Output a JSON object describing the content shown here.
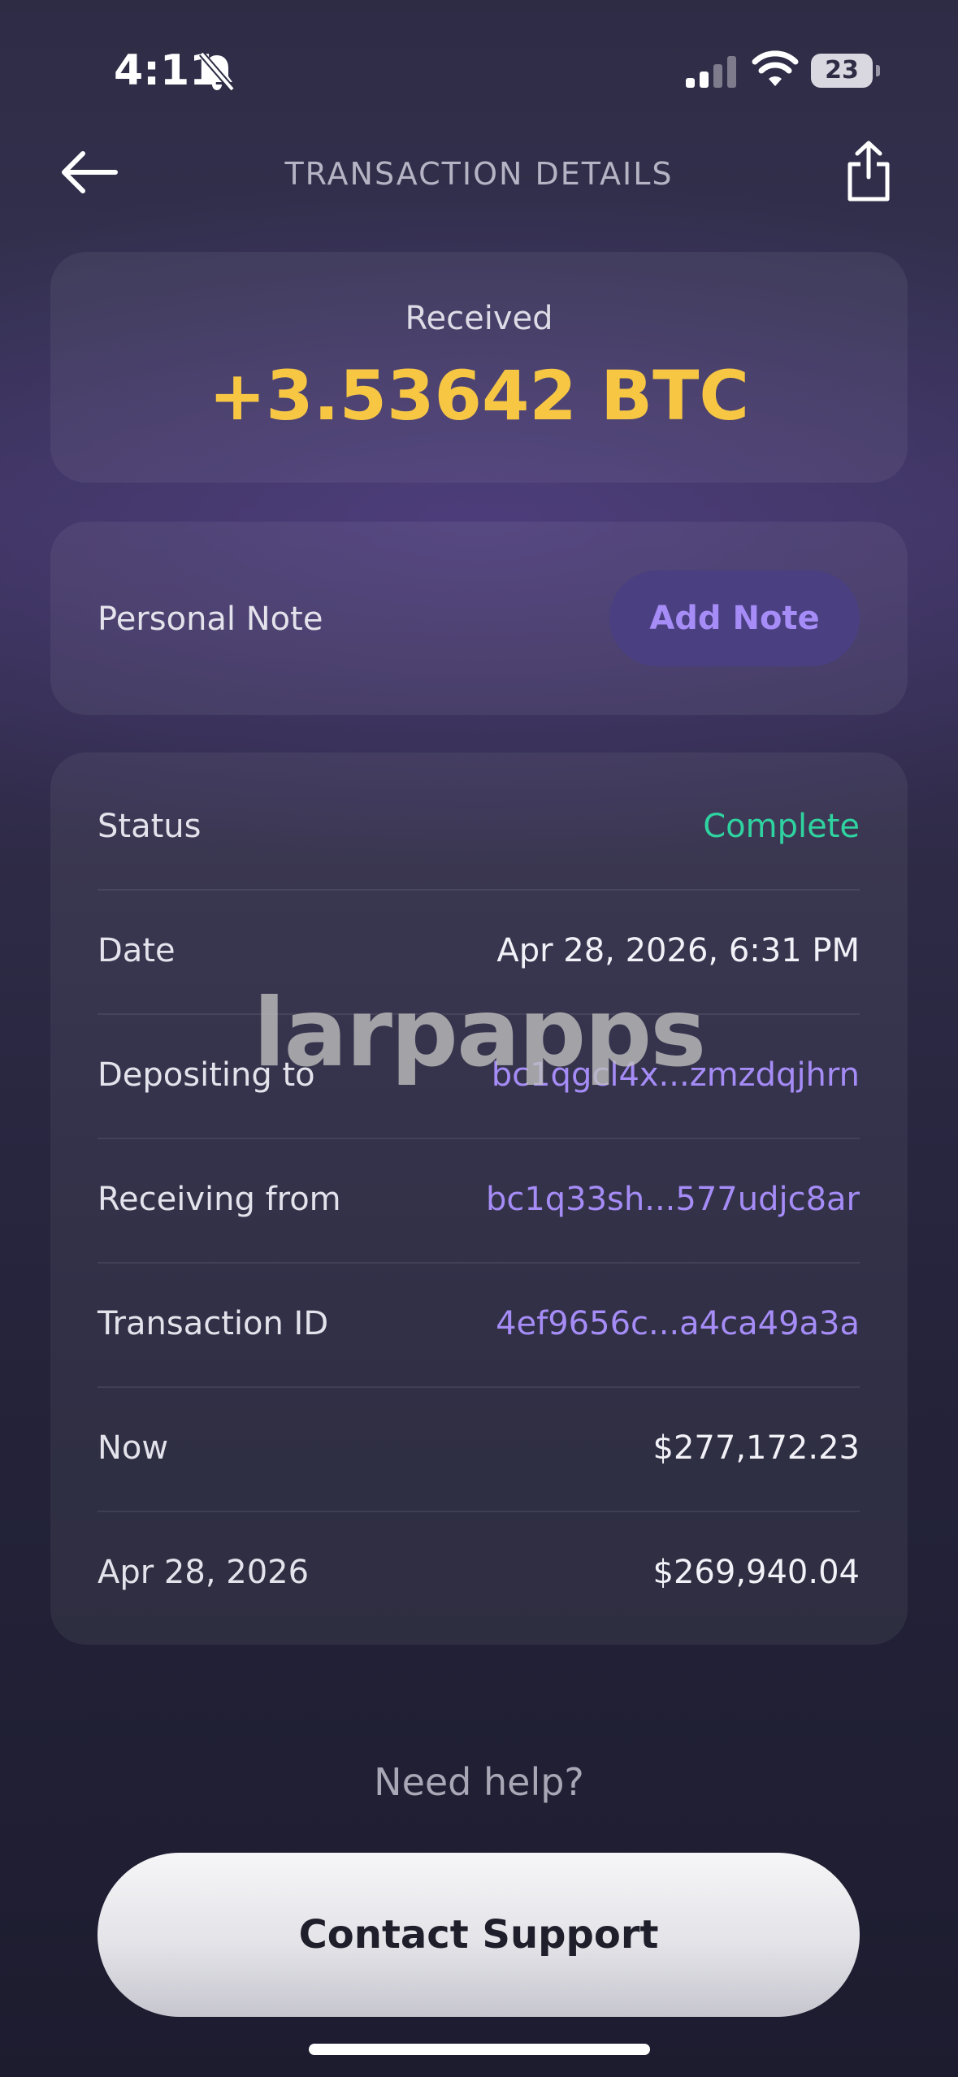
{
  "status_bar": {
    "time": "4:11",
    "battery": "23",
    "icons": [
      "bell-slash-icon",
      "cellular-signal-icon",
      "wifi-icon",
      "battery-icon"
    ]
  },
  "header": {
    "title": "TRANSACTION DETAILS",
    "back_icon": "arrow-left-icon",
    "share_icon": "share-icon"
  },
  "summary": {
    "label": "Received",
    "amount": "+3.53642 BTC",
    "amount_color": "#f7c744"
  },
  "note": {
    "label": "Personal Note",
    "button_label": "Add Note"
  },
  "details": {
    "rows": [
      {
        "key": "Status",
        "value": "Complete"
      },
      {
        "key": "Date",
        "value": "Apr 28, 2026, 6:31 PM"
      },
      {
        "key": "Depositing to",
        "value": "bc1qgcl4x...zmzdqjhrn"
      },
      {
        "key": "Receiving from",
        "value": "bc1q33sh...577udjc8ar"
      },
      {
        "key": "Transaction ID",
        "value": "4ef9656c...a4ca49a3a"
      },
      {
        "key": "Now",
        "value": "$277,172.23"
      },
      {
        "key": "Apr 28, 2026",
        "value": "$269,940.04"
      }
    ]
  },
  "watermark": "larpapps",
  "help": {
    "text": "Need help?",
    "button_label": "Contact Support"
  },
  "colors": {
    "accent_purple": "#a58cf6",
    "status_green": "#2fd3a0",
    "amount_gold": "#f7c744"
  }
}
